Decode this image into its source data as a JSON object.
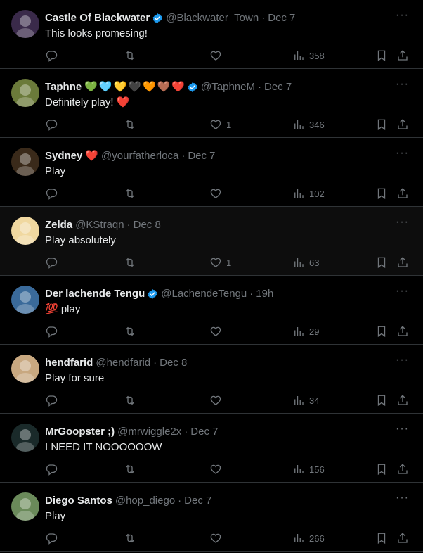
{
  "tweets": [
    {
      "name": "Castle Of Blackwater",
      "verified": true,
      "emojis": [],
      "handle": "@Blackwater_Town",
      "time": "Dec 7",
      "text": "This looks promesing!",
      "likes": "",
      "views": "358",
      "avatar_color": "#3a2a4a",
      "highlighted": false
    },
    {
      "name": "Taphne",
      "verified": true,
      "emojis": [
        "💚",
        "🩵",
        "💛",
        "🖤",
        "🧡",
        "🤎",
        "❤️"
      ],
      "handle": "@TaphneM",
      "time": "Dec 7",
      "text": "Definitely play! ❤️",
      "likes": "1",
      "views": "346",
      "avatar_color": "#6b7a3a",
      "highlighted": false
    },
    {
      "name": "Sydney",
      "verified": false,
      "emojis": [
        "❤️"
      ],
      "handle": "@yourfatherloca",
      "time": "Dec 7",
      "text": "Play",
      "likes": "",
      "views": "102",
      "avatar_color": "#3a2a1a",
      "highlighted": false
    },
    {
      "name": "Zelda",
      "verified": false,
      "emojis": [],
      "handle": "@KStraqn",
      "time": "Dec 8",
      "text": "Play absolutely",
      "likes": "1",
      "views": "63",
      "avatar_color": "#f0d8a0",
      "highlighted": true
    },
    {
      "name": "Der lachende Tengu",
      "verified": true,
      "emojis": [],
      "handle": "@LachendeTengu",
      "time": "19h",
      "text": "💯 play",
      "likes": "",
      "views": "29",
      "avatar_color": "#3a6a9a",
      "highlighted": false
    },
    {
      "name": "hendfarid",
      "verified": false,
      "emojis": [],
      "handle": "@hendfarid",
      "time": "Dec 8",
      "text": "Play for sure",
      "likes": "",
      "views": "34",
      "avatar_color": "#c8a880",
      "highlighted": false
    },
    {
      "name": "MrGoopster ;)",
      "verified": false,
      "emojis": [],
      "handle": "@mrwiggle2x",
      "time": "Dec 7",
      "text": "I NEED IT NOOOOOOW",
      "likes": "",
      "views": "156",
      "avatar_color": "#1a2a2a",
      "highlighted": false
    },
    {
      "name": "Diego Santos",
      "verified": false,
      "emojis": [],
      "handle": "@hop_diego",
      "time": "Dec 7",
      "text": "Play",
      "likes": "",
      "views": "266",
      "avatar_color": "#6a8a5a",
      "highlighted": false
    }
  ],
  "colors": {
    "background": "#000000",
    "text": "#e7e9ea",
    "muted": "#71767b",
    "divider": "#2f3336",
    "verified": "#1d9bf0"
  }
}
